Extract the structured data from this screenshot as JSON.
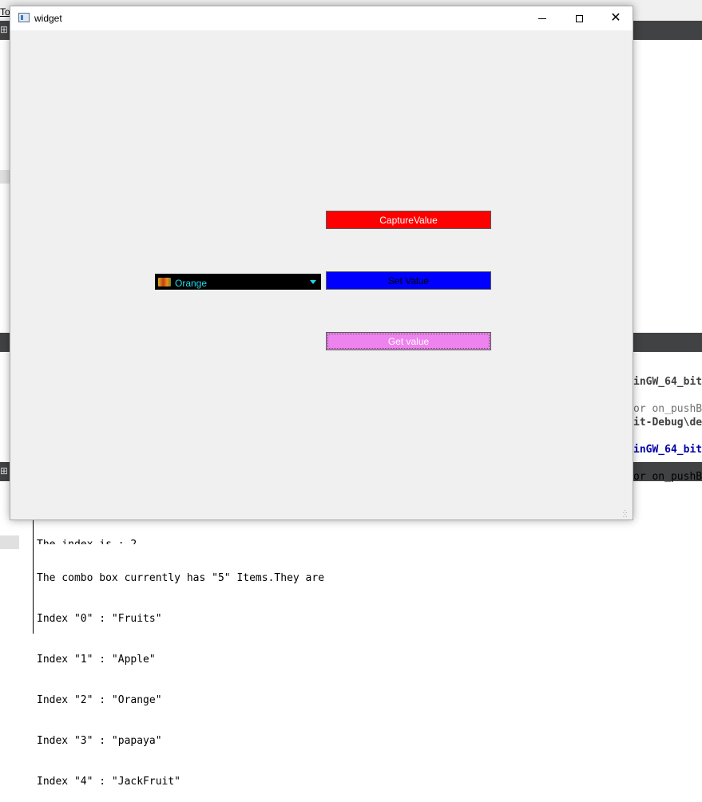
{
  "window": {
    "title": "widget"
  },
  "buttons": {
    "capture_label": "CaptureValue",
    "set_label": "Set Value",
    "get_label": "Get value"
  },
  "combo": {
    "selected": "Orange"
  },
  "colors": {
    "capture_bg": "#ff0000",
    "set_bg": "#0000ff",
    "get_bg": "#ee82ee",
    "combo_bg": "#000000",
    "combo_text": "#20d8e8"
  },
  "background_ide": {
    "menu_fragment": "To",
    "code_lines": [
      "inGW_64_bit",
      "or on_pushB",
      "it-Debug\\de",
      "inGW_64_bit",
      "or on_pushB"
    ]
  },
  "console": {
    "clipped_line": "The index is : 2",
    "lines": [
      "The combo box currently has \"5\" Items.They are",
      "Index \"0\" : \"Fruits\"",
      "Index \"1\" : \"Apple\"",
      "Index \"2\" : \"Orange\"",
      "Index \"3\" : \"papaya\"",
      "Index \"4\" : \"JackFruit\""
    ]
  }
}
